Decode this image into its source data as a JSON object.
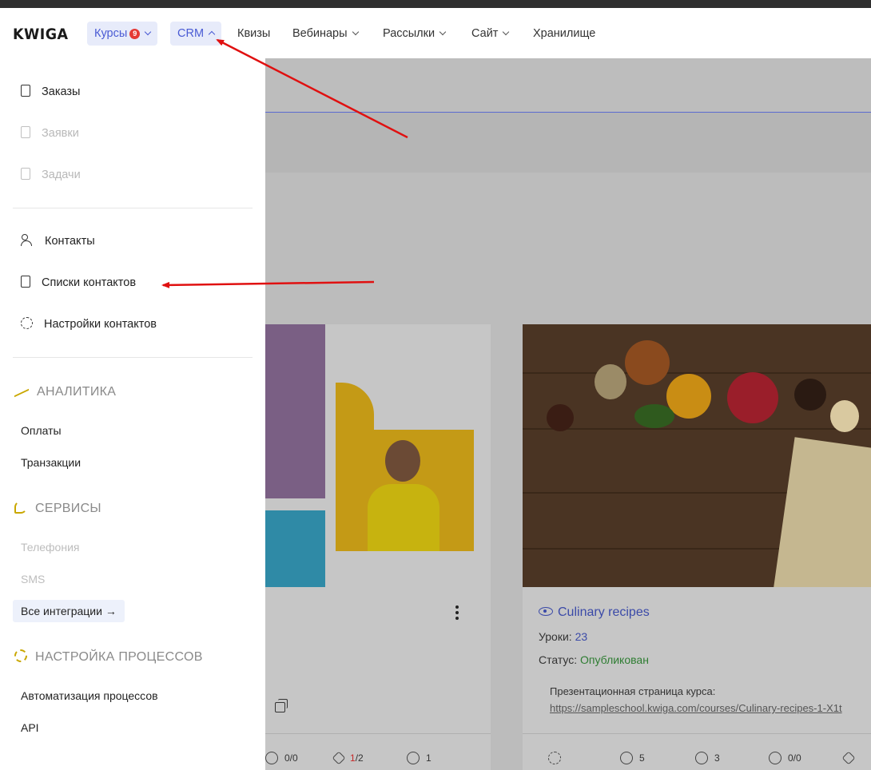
{
  "header": {
    "logo": "KWIGA",
    "nav": [
      {
        "label": "Курсы",
        "badge": "9"
      },
      {
        "label": "CRM"
      },
      {
        "label": "Квизы"
      },
      {
        "label": "Вебинары"
      },
      {
        "label": "Рассылки"
      },
      {
        "label": "Сайт"
      },
      {
        "label": "Хранилище"
      }
    ]
  },
  "crm_menu": {
    "orders": "Заказы",
    "requests": "Заявки",
    "tasks": "Задачи",
    "contacts": "Контакты",
    "contact_lists": "Списки контактов",
    "contact_settings": "Настройки контактов",
    "analytics": {
      "title": "АНАЛИТИКА",
      "items": [
        "Оплаты",
        "Транзакции"
      ]
    },
    "services": {
      "title": "СЕРВИСЫ",
      "items": [
        "Телефония",
        "SMS"
      ],
      "all_integrations": "Все интеграции →"
    },
    "process_settings": {
      "title": "НАСТРОЙКА ПРОЦЕССОВ",
      "items": [
        "Автоматизация процессов",
        "API"
      ]
    }
  },
  "course_card_2": {
    "title": "Culinary recipes",
    "lessons_label": "Уроки:",
    "lessons_value": "23",
    "status_label": "Статус:",
    "status_value": "Опубликован",
    "promo_label": "Презентационная страница курса:",
    "promo_link": "https://sampleschool.kwiga.com/courses/Culinary-recipes-1-X1t",
    "stats": [
      "5",
      "3",
      "0/0"
    ]
  },
  "course_card_1": {
    "stats": [
      "0/0",
      "1",
      "/2",
      "1"
    ]
  },
  "colors": {
    "accent": "#4a5bd4",
    "annotation_arrow": "#e01010",
    "section_icon": "#c9a700",
    "published": "#2e7d32"
  }
}
